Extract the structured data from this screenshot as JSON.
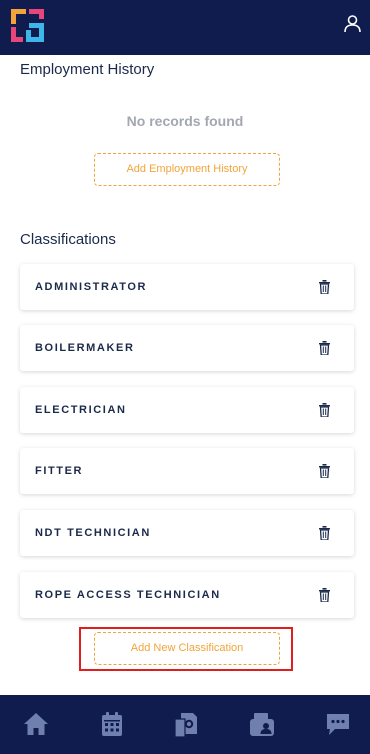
{
  "colors": {
    "nav_bg": "#0f1c4d",
    "accent": "#f2a43a",
    "highlight": "#e01e1e",
    "nav_icon": "#6f7fae"
  },
  "header": {
    "logo_icon": "app-logo",
    "profile_icon": "user-icon"
  },
  "employment": {
    "title": "Employment History",
    "empty_text": "No records found",
    "add_label": "Add Employment History"
  },
  "classifications": {
    "title": "Classifications",
    "items": [
      {
        "label": "ADMINISTRATOR"
      },
      {
        "label": "BOILERMAKER"
      },
      {
        "label": "ELECTRICIAN"
      },
      {
        "label": "FITTER"
      },
      {
        "label": "NDT TECHNICIAN"
      },
      {
        "label": "ROPE ACCESS TECHNICIAN"
      }
    ],
    "add_label": "Add New Classification"
  },
  "bottom_nav": [
    "home-icon",
    "calendar-icon",
    "documents-icon",
    "wallet-icon",
    "chat-icon"
  ]
}
